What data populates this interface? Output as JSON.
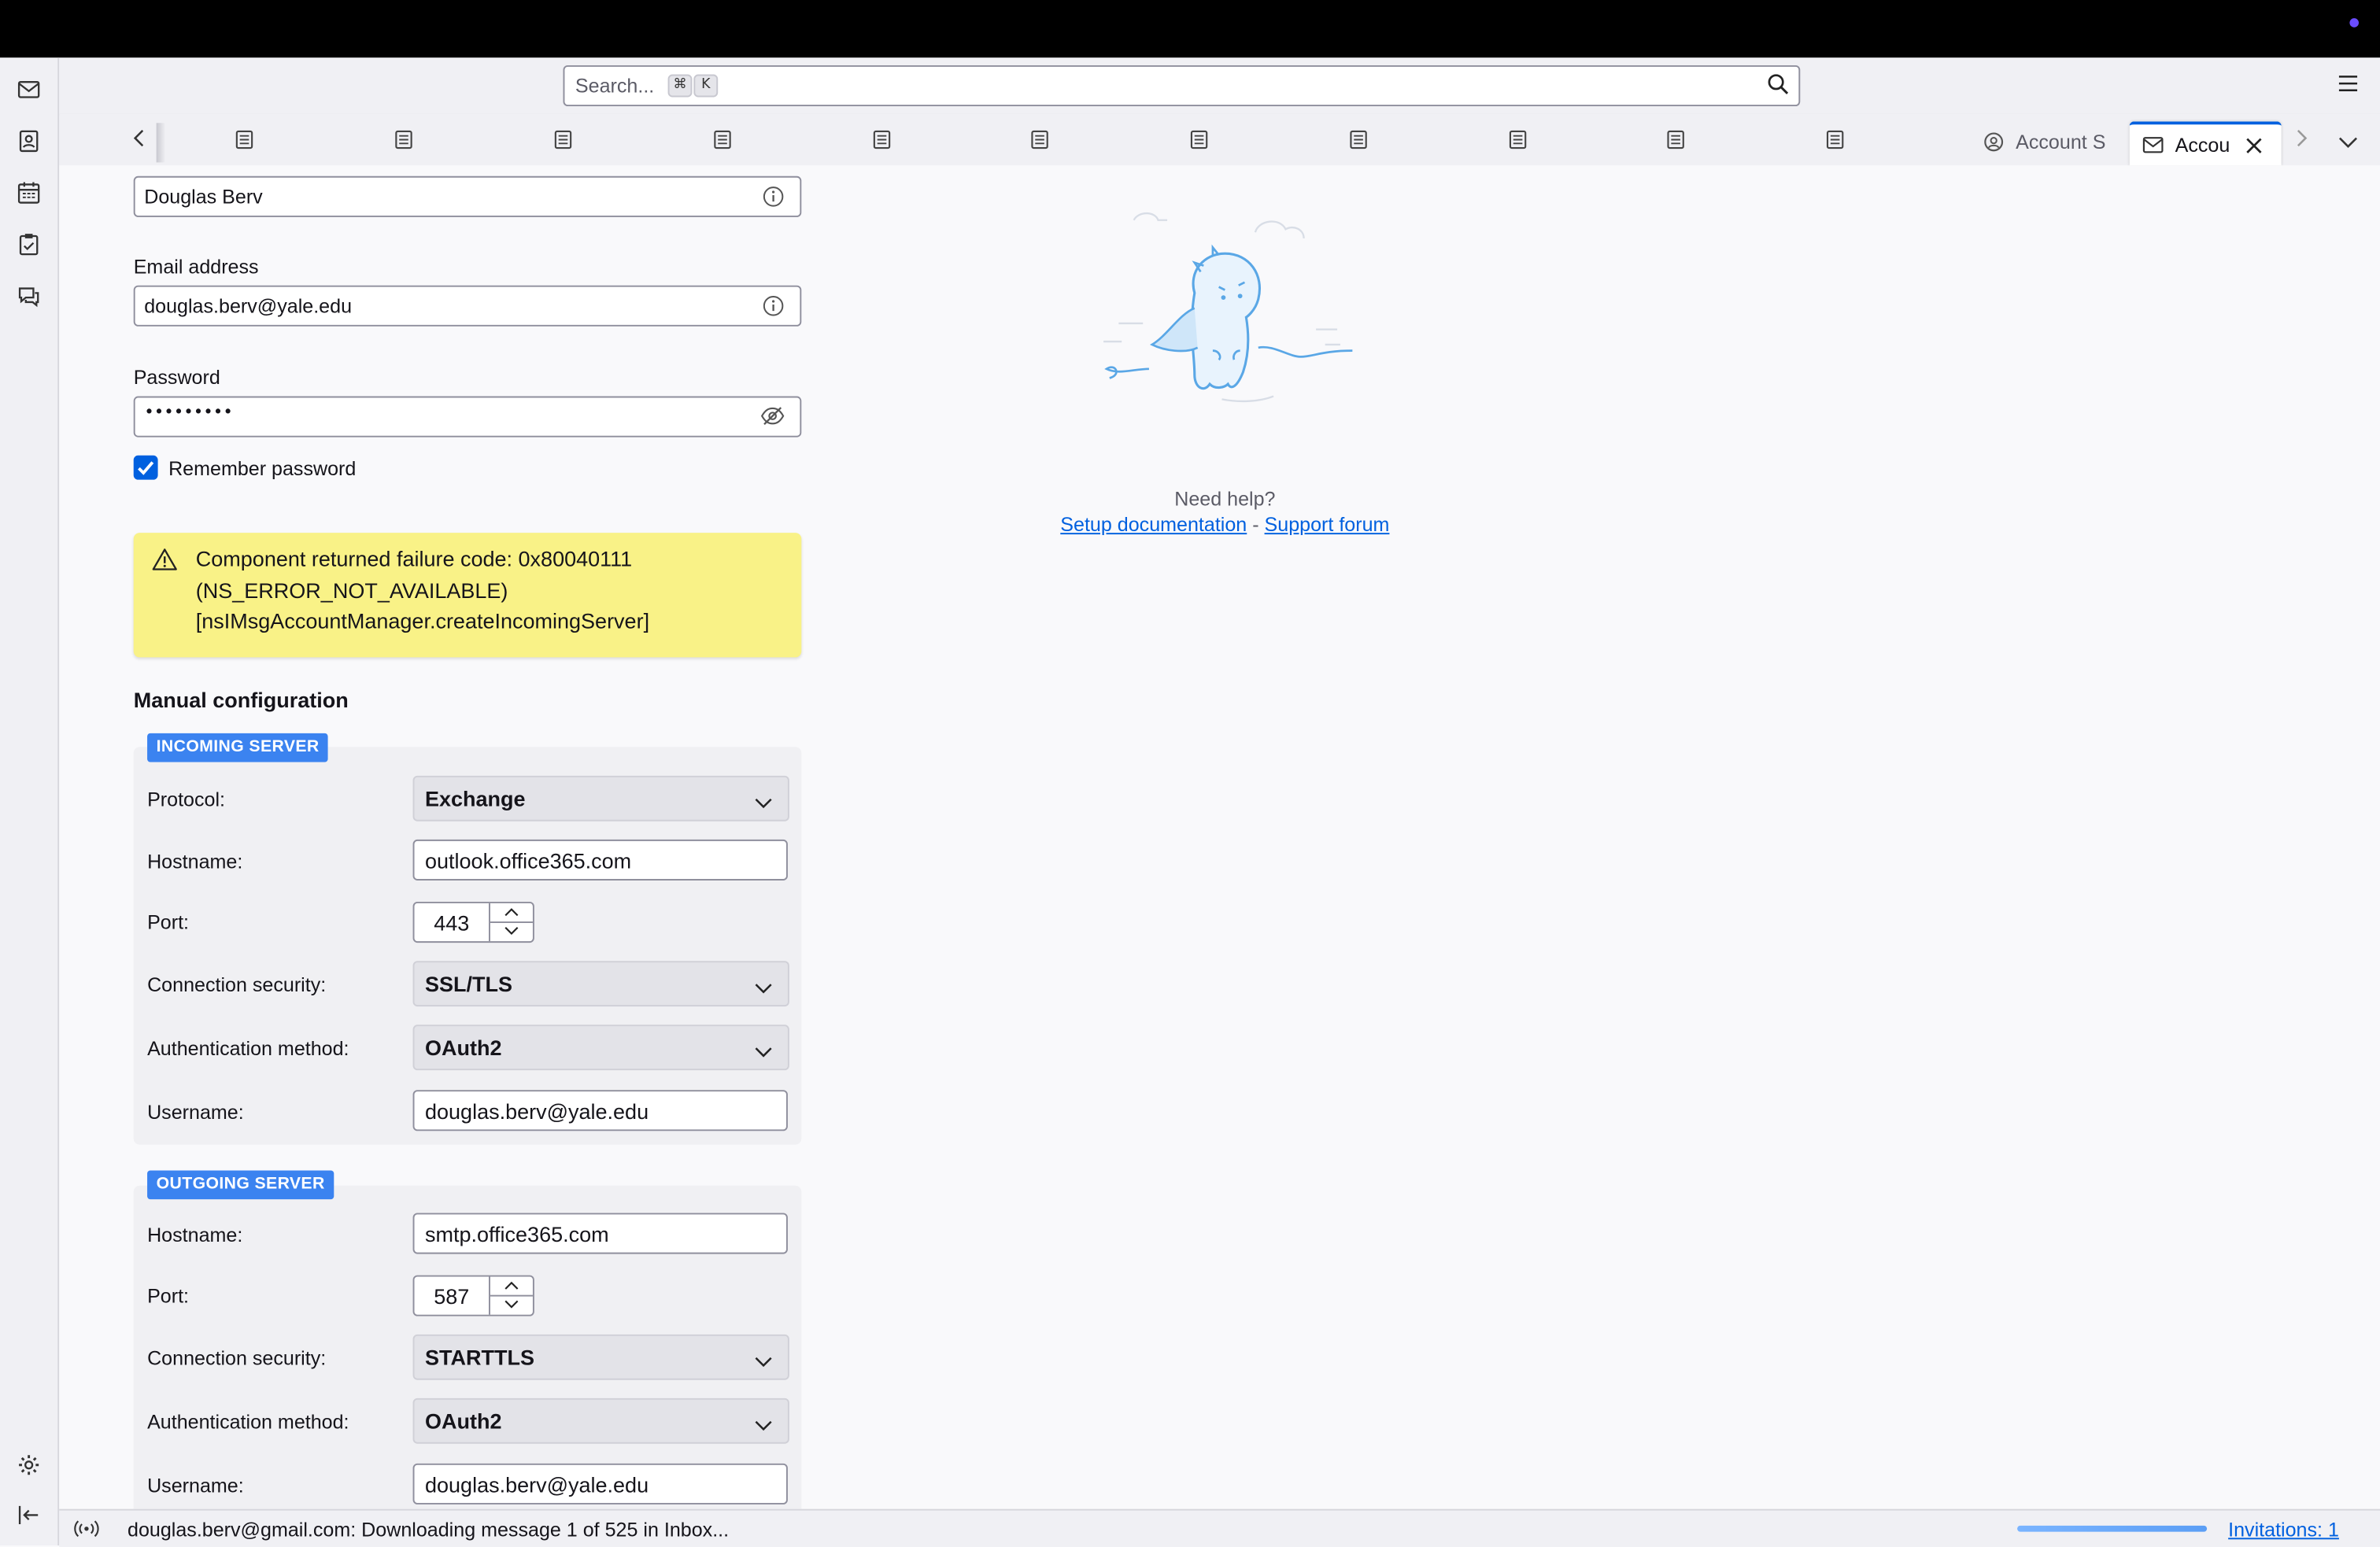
{
  "search": {
    "placeholder": "Search...",
    "key1": "⌘",
    "key2": "K"
  },
  "tabs": {
    "account_tab_1": "Account S",
    "account_tab_2": "Accou"
  },
  "form": {
    "name_value": "Douglas Berv",
    "email_label": "Email address",
    "email_value": "douglas.berv@yale.edu",
    "password_label": "Password",
    "password_value": "•••••••••",
    "remember_label": "Remember password",
    "remember_checked": true
  },
  "error": {
    "line1": "Component returned failure code: 0x80040111",
    "line2": "(NS_ERROR_NOT_AVAILABLE)",
    "line3": "[nsIMsgAccountManager.createIncomingServer]"
  },
  "manual": {
    "title": "Manual configuration",
    "incoming": {
      "badge": "INCOMING SERVER",
      "protocol_label": "Protocol:",
      "protocol_value": "Exchange",
      "hostname_label": "Hostname:",
      "hostname_value": "outlook.office365.com",
      "port_label": "Port:",
      "port_value": "443",
      "security_label": "Connection security:",
      "security_value": "SSL/TLS",
      "auth_label": "Authentication method:",
      "auth_value": "OAuth2",
      "username_label": "Username:",
      "username_value": "douglas.berv@yale.edu"
    },
    "outgoing": {
      "badge": "OUTGOING SERVER",
      "hostname_label": "Hostname:",
      "hostname_value": "smtp.office365.com",
      "port_label": "Port:",
      "port_value": "587",
      "security_label": "Connection security:",
      "security_value": "STARTTLS",
      "auth_label": "Authentication method:",
      "auth_value": "OAuth2",
      "username_label": "Username:",
      "username_value": "douglas.berv@yale.edu"
    }
  },
  "help": {
    "need_help": "Need help?",
    "setup_doc": "Setup documentation",
    "separator": " - ",
    "support_forum": "Support forum"
  },
  "status": {
    "message": "douglas.berv@gmail.com: Downloading message 1 of 525 in Inbox...",
    "progress": 1,
    "invitations": "Invitations: 1"
  },
  "colors": {
    "accent": "#0060df",
    "badge": "#3b83f0",
    "warning_bg": "#f9f287"
  }
}
